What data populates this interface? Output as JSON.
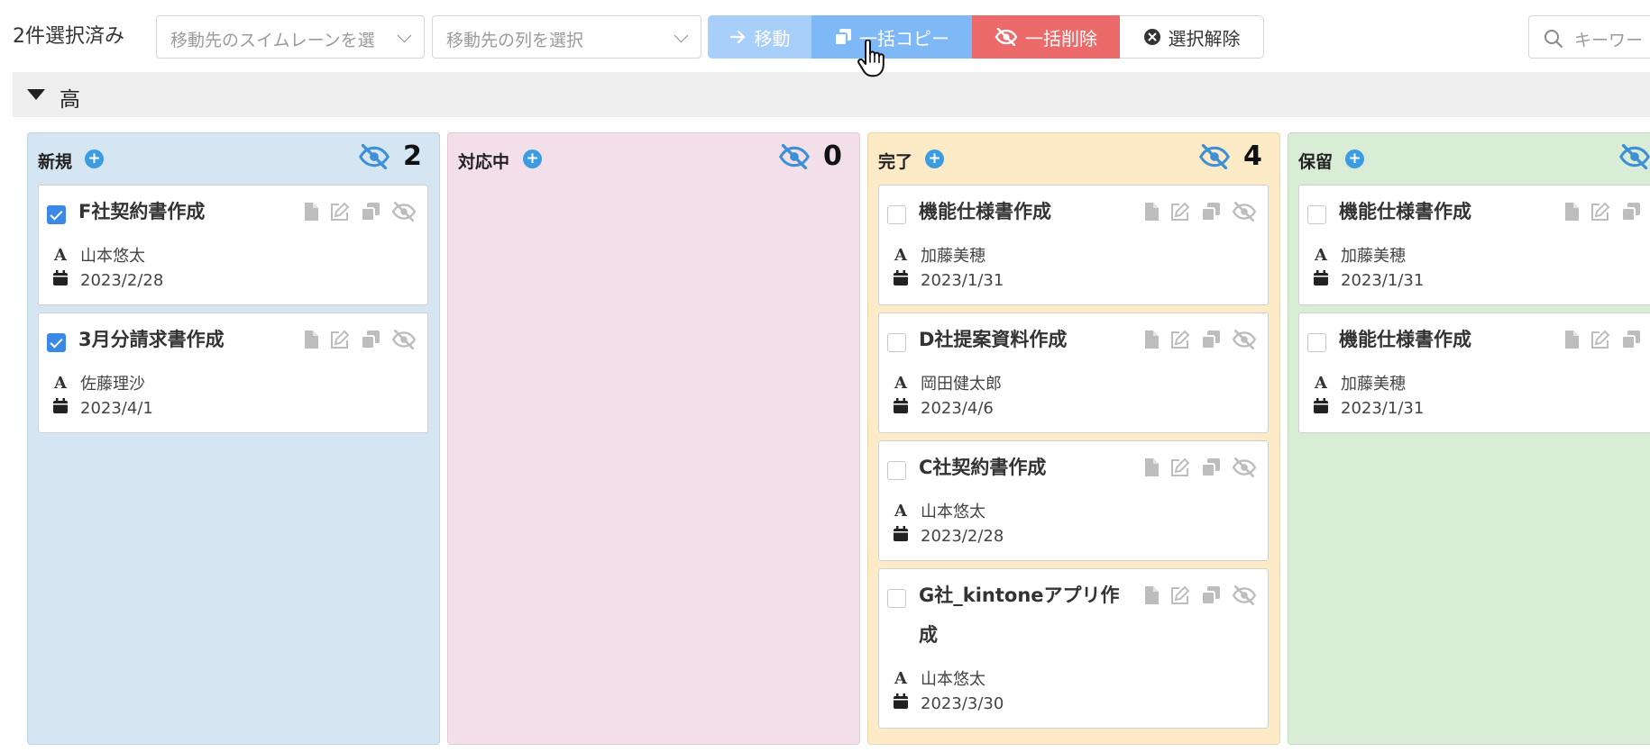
{
  "toolbar": {
    "selected_count": "2件選択済み",
    "swimlane_placeholder": "移動先のスイムレーンを選",
    "column_placeholder": "移動先の列を選択",
    "move_label": "移動",
    "bulk_copy_label": "一括コピー",
    "bulk_delete_label": "一括削除",
    "clear_selection_label": "選択解除",
    "search_placeholder": "キーワー"
  },
  "swimlane": {
    "name": "高"
  },
  "columns": [
    {
      "title": "新規",
      "count": "2",
      "bg": "#d5e6f2",
      "border": "#bcd3e4",
      "cards": [
        {
          "title": "F社契約書作成",
          "assignee": "山本悠太",
          "date": "2023/2/28",
          "checked": true
        },
        {
          "title": "3月分請求書作成",
          "assignee": "佐藤理沙",
          "date": "2023/4/1",
          "checked": true
        }
      ]
    },
    {
      "title": "対応中",
      "count": "0",
      "bg": "#f3dfea",
      "border": "#e3c9d7",
      "cards": []
    },
    {
      "title": "完了",
      "count": "4",
      "bg": "#fdebc8",
      "border": "#efd6a8",
      "cards": [
        {
          "title": "機能仕様書作成",
          "assignee": "加藤美穂",
          "date": "2023/1/31",
          "checked": false
        },
        {
          "title": "D社提案資料作成",
          "assignee": "岡田健太郎",
          "date": "2023/4/6",
          "checked": false
        },
        {
          "title": "C社契約書作成",
          "assignee": "山本悠太",
          "date": "2023/2/28",
          "checked": false
        },
        {
          "title": "G社_kintoneアプリ作成",
          "assignee": "山本悠太",
          "date": "2023/3/30",
          "checked": false
        }
      ]
    },
    {
      "title": "保留",
      "count": "",
      "bg": "#d9ecd6",
      "border": "#c1dbbd",
      "cards": [
        {
          "title": "機能仕様書作成",
          "assignee": "加藤美穂",
          "date": "2023/1/31",
          "checked": false
        },
        {
          "title": "機能仕様書作成",
          "assignee": "加藤美穂",
          "date": "2023/1/31",
          "checked": false
        }
      ]
    }
  ]
}
